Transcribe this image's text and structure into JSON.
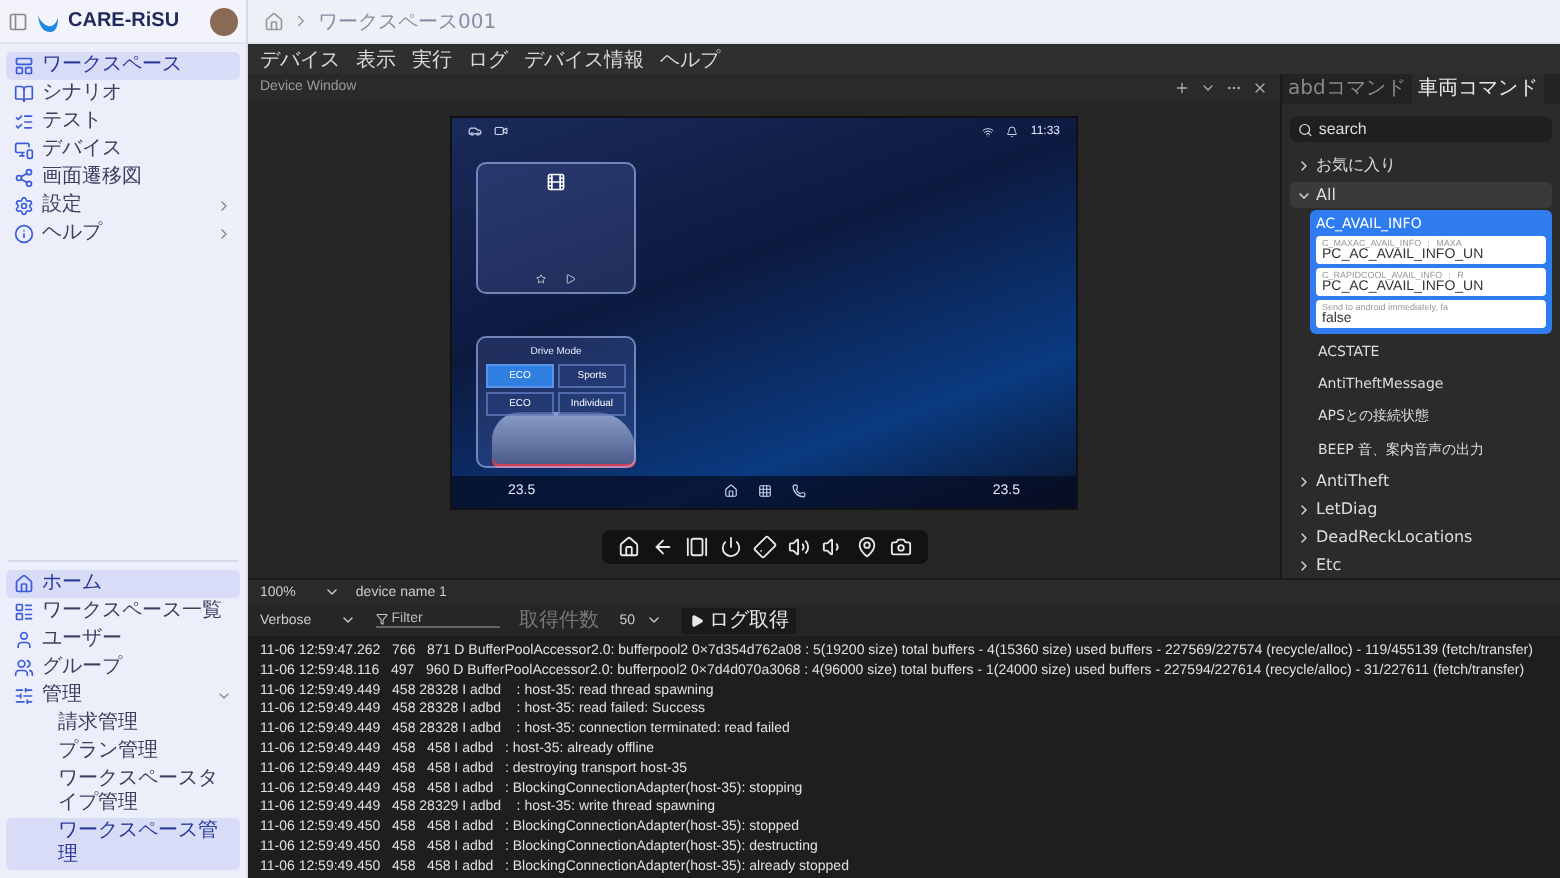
{
  "sidebar": {
    "brand": "CARE-RiSU",
    "top_items": [
      {
        "label": "ワークスペース",
        "selected": true
      },
      {
        "label": "シナリオ",
        "selected": false
      },
      {
        "label": "テスト",
        "selected": false
      },
      {
        "label": "デバイス",
        "selected": false
      },
      {
        "label": "画面遷移図",
        "selected": false
      },
      {
        "label": "設定",
        "selected": false,
        "expanded": false
      },
      {
        "label": "ヘルプ",
        "selected": false,
        "expanded": false
      }
    ],
    "bottom_items": [
      {
        "label": "ホーム",
        "selected": true
      },
      {
        "label": "ワークスペース一覧",
        "selected": false
      },
      {
        "label": "ユーザー",
        "selected": false
      },
      {
        "label": "グループ",
        "selected": false
      },
      {
        "label": "管理",
        "selected": false,
        "expanded": true,
        "children": [
          {
            "label": "請求管理",
            "selected": false
          },
          {
            "label": "プラン管理",
            "selected": false
          },
          {
            "label": "ワークスペースタイプ管理",
            "selected": false
          },
          {
            "label": "ワークスペース管理",
            "selected": true
          }
        ]
      }
    ]
  },
  "breadcrumb": [
    "ワークスペース001"
  ],
  "menubar": [
    "デバイス",
    "表示",
    "実行",
    "ログ",
    "デバイス情報",
    "ヘルプ"
  ],
  "device_window": {
    "title": "Device Window",
    "screen": {
      "time": "11:33",
      "drive_mode": {
        "title": "Drive Mode",
        "options": [
          {
            "label": "ECO",
            "selected": true
          },
          {
            "label": "Sports",
            "selected": false
          },
          {
            "label": "ECO",
            "selected": false
          },
          {
            "label": "Individual",
            "selected": false
          }
        ]
      },
      "temps": [
        "23.5",
        "23.5"
      ]
    },
    "zoom": "100%",
    "device_name": "device name 1"
  },
  "command_panel": {
    "tabs": [
      {
        "label": "abdコマンド",
        "selected": false
      },
      {
        "label": "車両コマンド",
        "selected": true
      }
    ],
    "search": {
      "placeholder": "search"
    },
    "groups": [
      {
        "label": "お気に入り",
        "expanded": false
      },
      {
        "label": "All",
        "expanded": true,
        "children": [
          {
            "label": "AC_AVAIL_INFO",
            "selected": true,
            "fields": [
              {
                "caption": "C_MAXAC_AVAIL_INFO ： MAXA",
                "value": "PC_AC_AVAIL_INFO_UN"
              },
              {
                "caption": "C_RAPIDCOOL_AVAIL_INFO ： R",
                "value": "PC_AC_AVAIL_INFO_UN"
              },
              {
                "caption": "Send to android immediately, fa",
                "value": "false"
              }
            ]
          },
          {
            "label": "ACSTATE",
            "selected": false
          },
          {
            "label": "AntiTheftMessage",
            "selected": false
          },
          {
            "label": "APSとの接続状態",
            "selected": false
          },
          {
            "label": "BEEP 音、案内音声の出力",
            "selected": false
          }
        ]
      },
      {
        "label": "AntiTheft",
        "expanded": false
      },
      {
        "label": "LetDiag",
        "expanded": false
      },
      {
        "label": "DeadReckLocations",
        "expanded": false
      },
      {
        "label": "Etc",
        "expanded": false
      }
    ]
  },
  "log": {
    "level": "Verbose",
    "filter_placeholder": "Filter",
    "count_label": "取得件数",
    "count": "50",
    "fetch_button": "ログ取得",
    "lines": [
      "11-06 12:59:47.262   766   871 D BufferPoolAccessor2.0: bufferpool2 0×7d354d762a08 : 5(19200 size) total buffers - 4(15360 size) used buffers - 227569/227574 (recycle/alloc) - 119/455139 (fetch/transfer)",
      "11-06 12:59:48.116   497   960 D BufferPoolAccessor2.0: bufferpool2 0×7d4d070a3068 : 4(96000 size) total buffers - 1(24000 size) used buffers - 227594/227614 (recycle/alloc) - 31/227611 (fetch/transfer)",
      "11-06 12:59:49.449   458 28328 I adbd    : host-35: read thread spawning",
      "11-06 12:59:49.449   458 28328 I adbd    : host-35: read failed: Success",
      "11-06 12:59:49.449   458 28328 I adbd    : host-35: connection terminated: read failed",
      "11-06 12:59:49.449   458   458 I adbd   : host-35: already offline",
      "11-06 12:59:49.449   458   458 I adbd   : destroying transport host-35",
      "11-06 12:59:49.449   458   458 I adbd   : BlockingConnectionAdapter(host-35): stopping",
      "11-06 12:59:49.449   458 28329 I adbd    : host-35: write thread spawning",
      "11-06 12:59:49.450   458   458 I adbd   : BlockingConnectionAdapter(host-35): stopped",
      "11-06 12:59:49.450   458   458 I adbd   : BlockingConnectionAdapter(host-35): destructing",
      "11-06 12:59:49.450   458   458 I adbd   : BlockingConnectionAdapter(host-35): already stopped"
    ]
  }
}
